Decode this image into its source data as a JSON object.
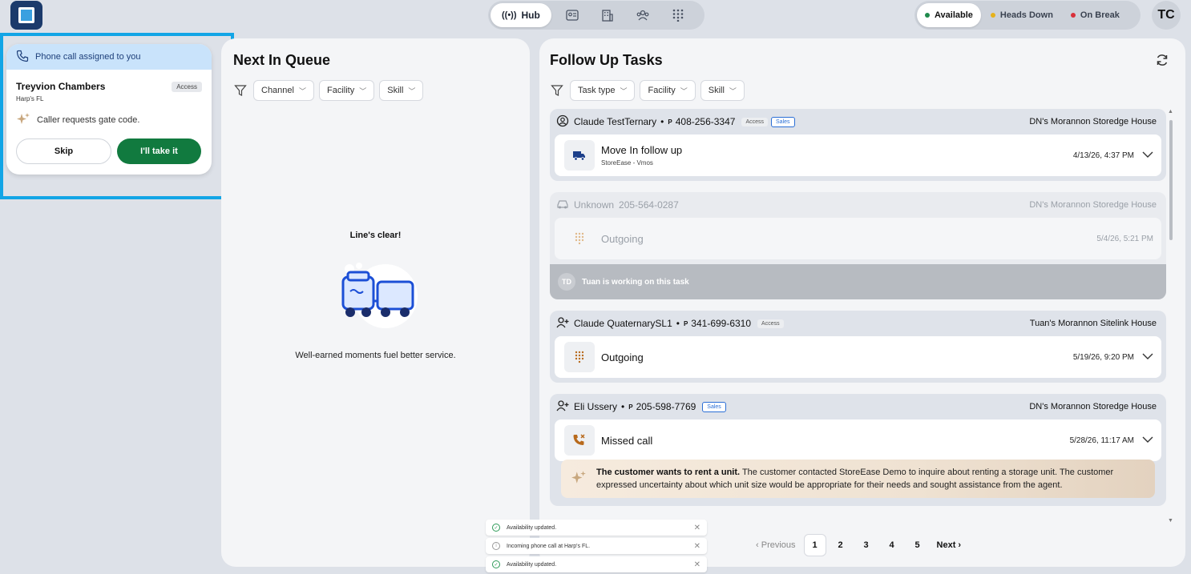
{
  "topbar": {
    "nav": {
      "hub_label": "Hub",
      "hub_icon": "broadcast-icon",
      "icons": [
        "contact-card-icon",
        "building-icon",
        "team-icon",
        "dialpad-icon"
      ]
    },
    "status": {
      "available": "Available",
      "heads_down": "Heads Down",
      "on_break": "On Break",
      "colors": {
        "available": "#1f8a4c",
        "heads_down": "#e6b21a",
        "on_break": "#d9303a"
      }
    },
    "user_initials": "TC"
  },
  "call_assignment": {
    "header": "Phone call assigned to you",
    "caller_name": "Treyvion Chambers",
    "tag": "Access",
    "facility": "Harp's FL",
    "note": "Caller requests gate code.",
    "skip_label": "Skip",
    "take_label": "I'll take it"
  },
  "queue": {
    "title": "Next In Queue",
    "filters": [
      "Channel",
      "Facility",
      "Skill"
    ],
    "empty_title": "Line's clear!",
    "empty_subtitle": "Well-earned moments fuel better service."
  },
  "tasks": {
    "title": "Follow Up Tasks",
    "filters": [
      "Task type",
      "Facility",
      "Skill"
    ],
    "items": [
      {
        "name": "Claude TestTernary",
        "phone_prefix": "P",
        "phone": "408-256-3347",
        "tags": [
          "Access",
          "Sales"
        ],
        "facility": "DN's Morannon Storedge House",
        "type": "Move In follow up",
        "source": "StoreEase - Vmos",
        "time": "4/13/26, 4:37 PM"
      },
      {
        "name": "Unknown",
        "phone": "205-564-0287",
        "facility": "DN's Morannon Storedge House",
        "type": "Outgoing",
        "time": "5/4/26, 5:21 PM",
        "working_initials": "TD",
        "working_text": "Tuan is working on this task"
      },
      {
        "name": "Claude QuaternarySL1",
        "phone_prefix": "P",
        "phone": "341-699-6310",
        "tags": [
          "Access"
        ],
        "facility": "Tuan's Morannon Sitelink House",
        "type": "Outgoing",
        "time": "5/19/26, 9:20 PM"
      },
      {
        "name": "Eli Ussery",
        "phone_prefix": "P",
        "phone": "205-598-7769",
        "tags": [
          "Sales"
        ],
        "facility": "DN's Morannon Storedge House",
        "type": "Missed call",
        "time": "5/28/26, 11:17 AM",
        "summary_bold": "The customer wants to rent a unit.",
        "summary_text": "The customer contacted StoreEase Demo to inquire about renting a storage unit. The customer expressed uncertainty about which unit size would be appropriate for their needs and sought assistance from the agent."
      }
    ],
    "pagination": {
      "previous": "Previous",
      "pages": [
        "1",
        "2",
        "3",
        "4",
        "5"
      ],
      "current": "1",
      "next": "Next"
    }
  },
  "toasts": [
    {
      "text": "Availability updated.",
      "kind": "success"
    },
    {
      "text": "Incoming phone call at Harp's FL.",
      "kind": "info"
    },
    {
      "text": "Availability updated.",
      "kind": "success"
    }
  ]
}
